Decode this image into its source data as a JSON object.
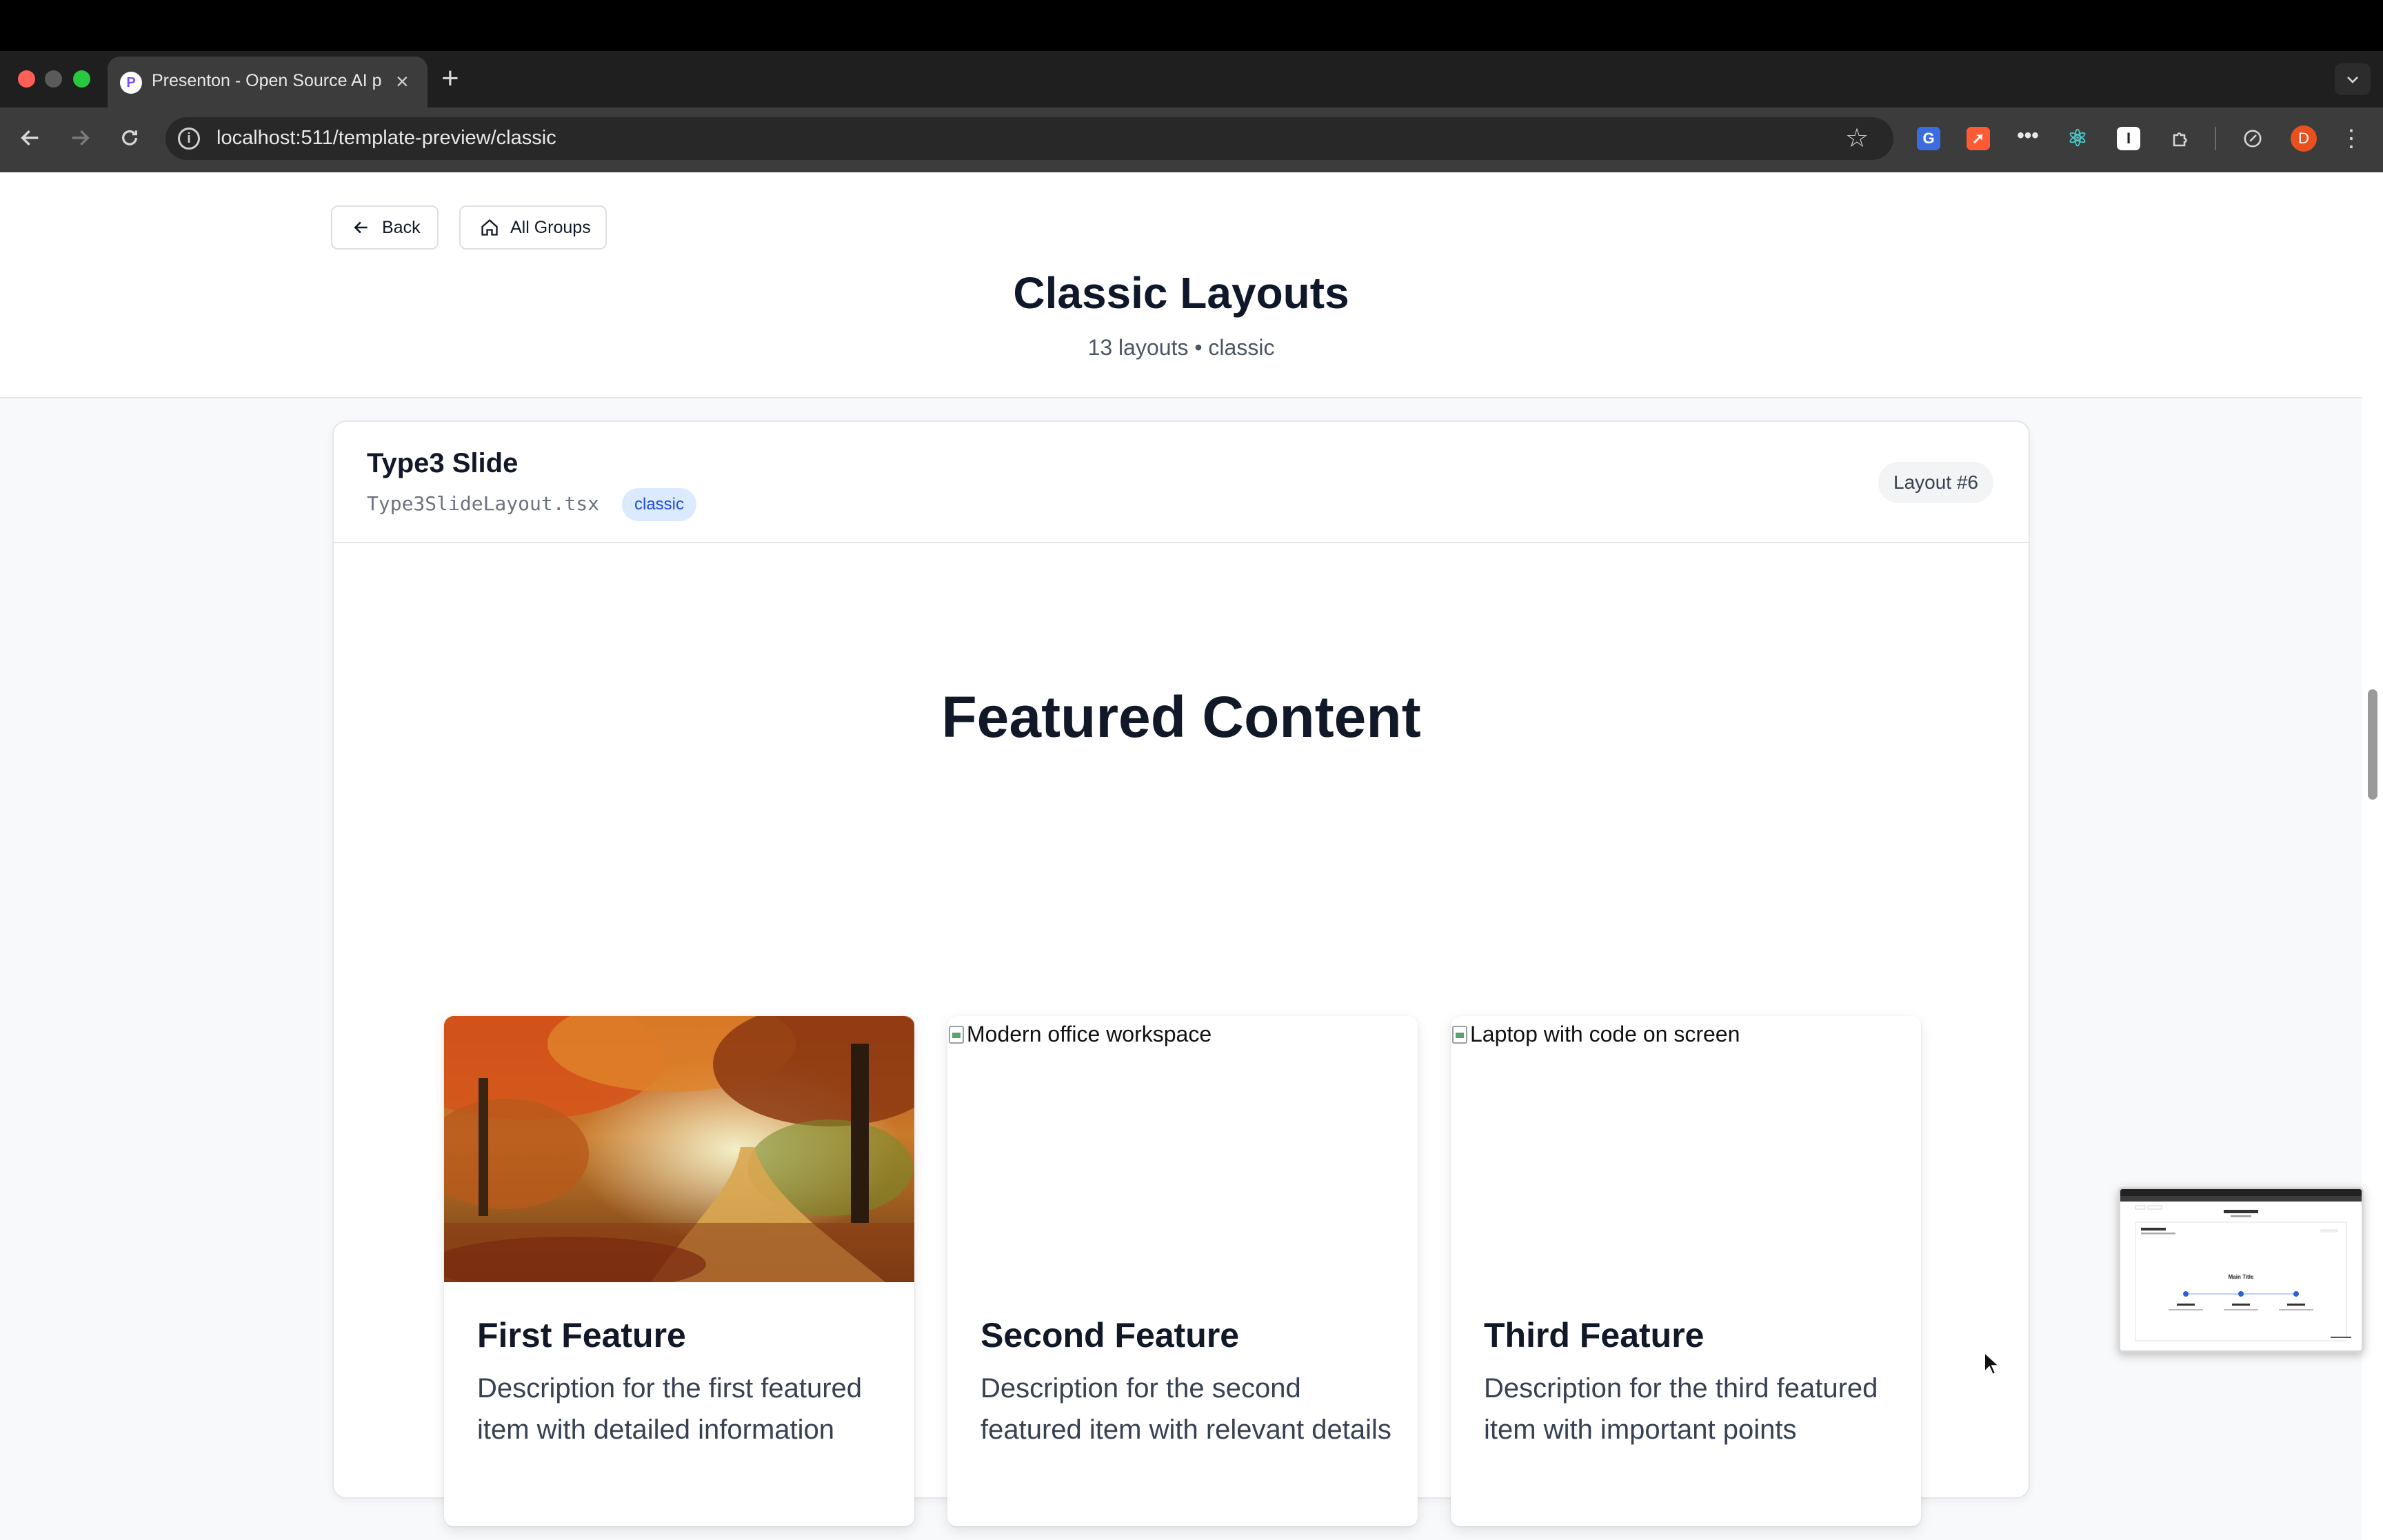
{
  "browser": {
    "tab_title": "Presenton - Open Source AI p",
    "tab_favicon": "P",
    "close_glyph": "×",
    "new_tab_glyph": "+",
    "url": "localhost:511/template-preview/classic",
    "profile_initial": "D",
    "colors": {
      "frame": "#1f1f1f",
      "toolbar": "#3c3c3c",
      "omnibox": "#282828",
      "profile": "#e8511f"
    }
  },
  "header": {
    "back_label": "Back",
    "groups_label": "All Groups",
    "title": "Classic Layouts",
    "subtitle": "13 layouts • classic"
  },
  "layout_card": {
    "name": "Type3 Slide",
    "file": "Type3SlideLayout.tsx",
    "tag": "classic",
    "number": "Layout #6"
  },
  "slide": {
    "title": "Featured Content",
    "features": [
      {
        "image_alt": "",
        "title": "First Feature",
        "description": "Description for the first featured item with detailed information"
      },
      {
        "image_alt": "Modern office workspace",
        "title": "Second Feature",
        "description": "Description for the second featured item with relevant details"
      },
      {
        "image_alt": "Laptop with code on screen",
        "title": "Third Feature",
        "description": "Description for the third featured item with important points"
      }
    ]
  },
  "mini_preview": {
    "title": "Main Title"
  },
  "icons": {
    "back": "arrow-left-icon",
    "groups": "home-icon",
    "info": "info-icon",
    "star": "star-icon",
    "extensions": "puzzle-icon"
  },
  "colors": {
    "accent_tag_bg": "#dbeafe",
    "accent_tag_text": "#1d4ed8",
    "page_bg": "#f8f9fb",
    "title_text": "#0f172a"
  }
}
